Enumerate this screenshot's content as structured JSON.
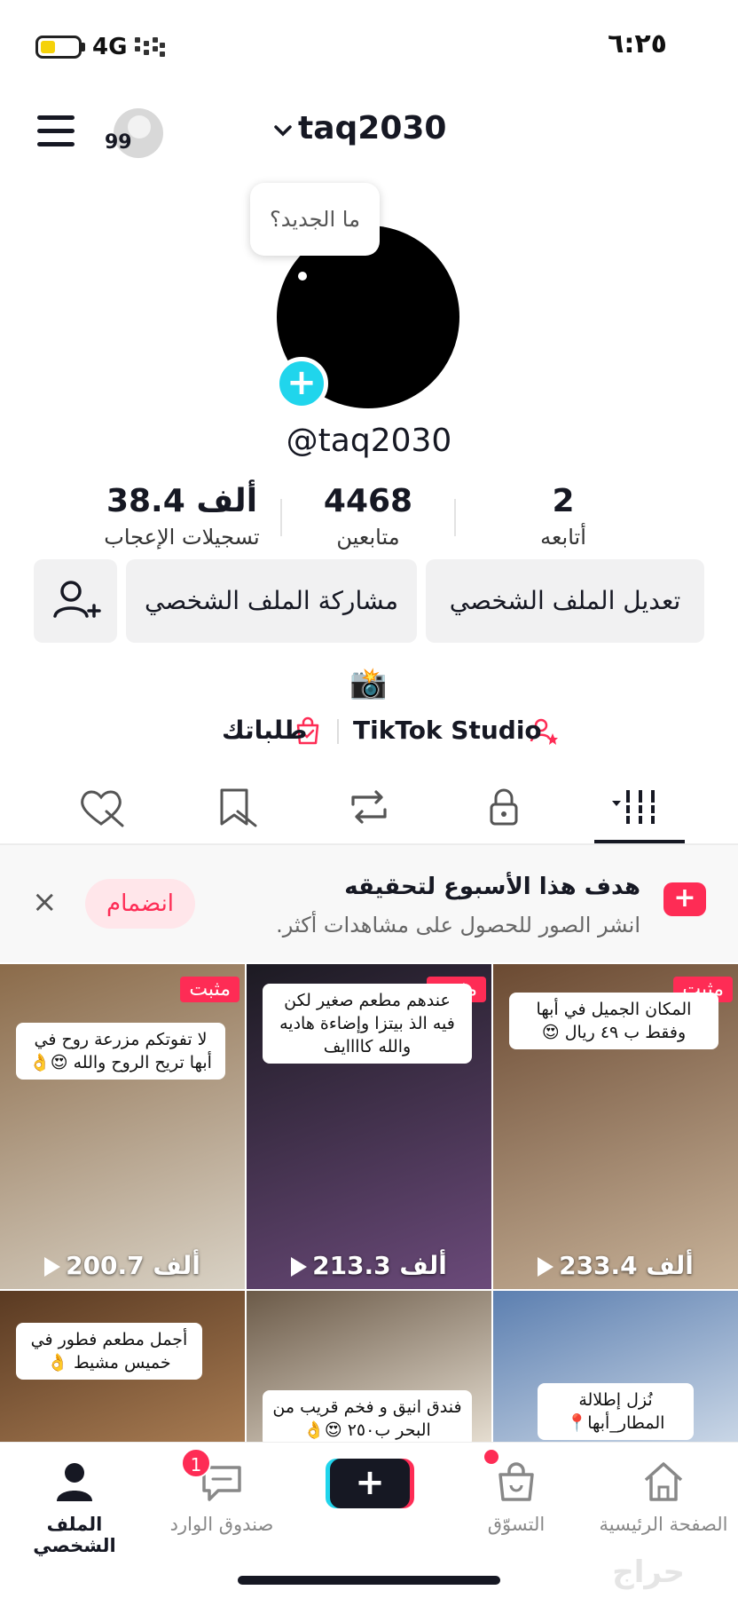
{
  "status": {
    "time": "٦:٢٥",
    "network": "4G",
    "battery_level": 0.4
  },
  "header": {
    "username": "taq2030",
    "followers_badge": "99",
    "menu_icon": "hamburger-icon"
  },
  "profile": {
    "bubble_text": "ما الجديد؟",
    "handle": "@taq2030"
  },
  "stats": {
    "following_count": "2",
    "following_label": "أتابعه",
    "followers_count": "4468",
    "followers_label": "متابعين",
    "likes_count": "38.4 ألف",
    "likes_label": "تسجيلات الإعجاب"
  },
  "buttons": {
    "edit": "تعديل الملف الشخصي",
    "share": "مشاركة الملف الشخصي"
  },
  "links": {
    "studio": "TikTok Studio",
    "orders": "طلباتك"
  },
  "goal": {
    "title": "هدف هذا الأسبوع لتحقيقه",
    "subtitle": "انشر الصور للحصول على مشاهدات أكثر.",
    "join": "انضمام",
    "close": "×"
  },
  "videos": [
    {
      "pinned": "مثبت",
      "caption": "لا تفوتكم مزرعة روح في أبها تريح الروح والله 😍👌",
      "views": "200.7 ألف",
      "colors": [
        "#8b6b4a",
        "#d9d2c5"
      ]
    },
    {
      "pinned": "مثبت",
      "caption": "عندهم مطعم صغير لكن فيه الذ بيتزا وإضاءة هاديه والله كاااايف",
      "views": "213.3 ألف",
      "colors": [
        "#1c1a22",
        "#6b4a7a"
      ]
    },
    {
      "pinned": "مثبت",
      "caption": "المكان الجميل في أبها وفقط ب ٤٩ ريال 😍",
      "views": "233.4 ألف",
      "colors": [
        "#6b4a32",
        "#c8b39a"
      ]
    },
    {
      "caption": "أجمل مطعم فطور في خميس مشيط 👌",
      "colors": [
        "#5a3a22",
        "#a77b52"
      ]
    },
    {
      "caption": "فندق انيق و فخم قريب من البحر ب٢٥٠ 😍👌",
      "colors": [
        "#6b5a48",
        "#e5ddd0"
      ]
    },
    {
      "caption": "نُزل إطلالة المطار_أبها📍",
      "colors": [
        "#5c7fb0",
        "#c9d6e6"
      ]
    }
  ],
  "nav": {
    "home": "الصفحة الرئيسية",
    "shop": "التسوّق",
    "inbox": "صندوق الوارد",
    "inbox_badge": "1",
    "profile": "الملف الشخصي",
    "create": "+"
  },
  "watermark": "حراج"
}
